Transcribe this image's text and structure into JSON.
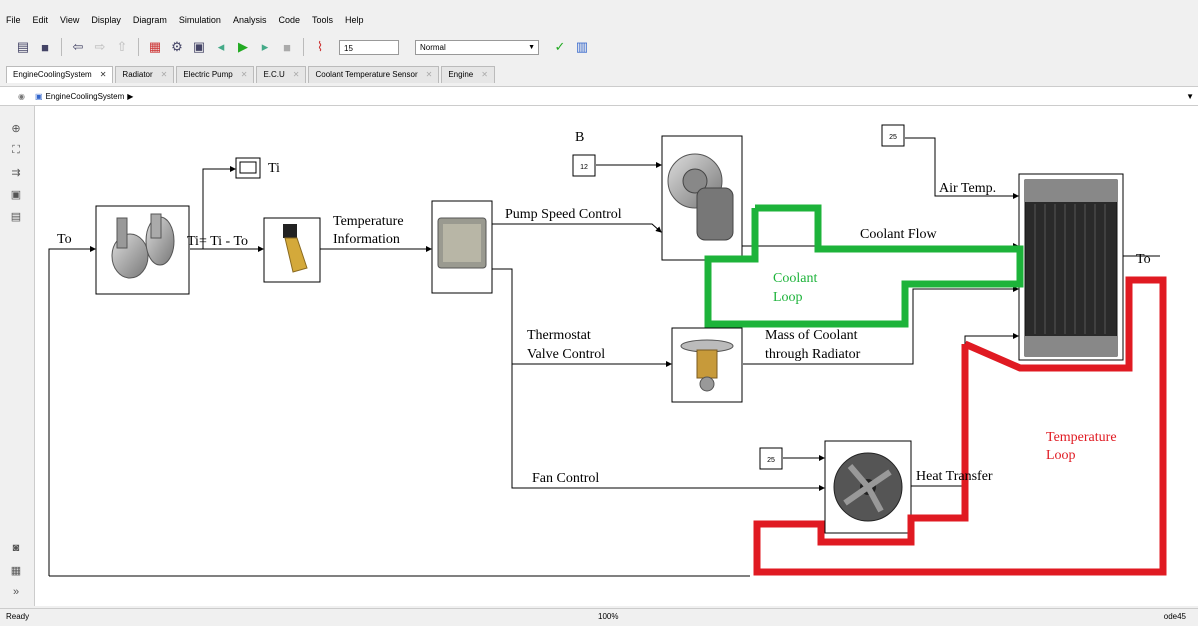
{
  "menu": [
    "File",
    "Edit",
    "View",
    "Display",
    "Diagram",
    "Simulation",
    "Analysis",
    "Code",
    "Tools",
    "Help"
  ],
  "toolbar": {
    "stop_time": "15",
    "sim_mode": "Normal"
  },
  "tabs": [
    "EngineCoolingSystem",
    "Radiator",
    "Electric Pump",
    "E.C.U",
    "Coolant Temperature Sensor",
    "Engine"
  ],
  "breadcrumb": "EngineCoolingSystem",
  "diagram": {
    "to_in": "To",
    "ti_scope": "Ti",
    "ti_eq": "Ti= Ti - To",
    "temp_info_1": "Temperature",
    "temp_info_2": "Information",
    "b_label": "B",
    "const_pump": "12",
    "const_air": "25",
    "const_fan": "25",
    "pump_speed": "Pump Speed Control",
    "air_temp": "Air Temp.",
    "coolant_flow": "Coolant Flow",
    "to_out": "To",
    "coolant_loop_1": "Coolant",
    "coolant_loop_2": "Loop",
    "thermostat_1": "Thermostat",
    "thermostat_2": "Valve Control",
    "mass_1": "Mass of Coolant",
    "mass_2": "through Radiator",
    "temp_loop_1": "Temperature",
    "temp_loop_2": "Loop",
    "fan_control": "Fan Control",
    "heat_transfer": "Heat Transfer"
  },
  "colors": {
    "coolant_loop": "#1db33a",
    "temperature_loop": "#e01a22"
  },
  "status": {
    "ready": "Ready",
    "zoom": "100%",
    "solver": "ode45"
  }
}
